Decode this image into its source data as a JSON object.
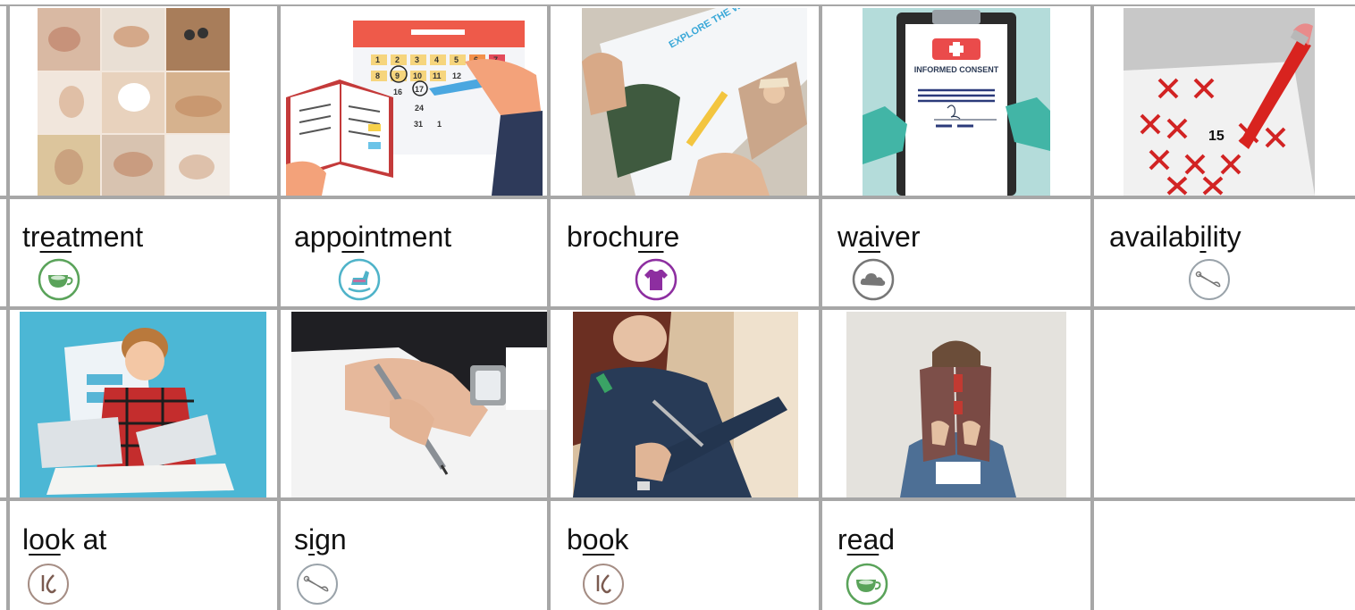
{
  "rows": [
    {
      "words": [
        {
          "pre": "tr",
          "key": "ea",
          "post": "tment",
          "icon": "teacup-icon",
          "icon_color": "#5aa35a"
        },
        {
          "pre": "app",
          "key": "oi",
          "post": "ntment",
          "icon": "rocking-horse-icon",
          "icon_color": "#4fb3c9"
        },
        {
          "pre": "broch",
          "key": "ur",
          "post": "e",
          "icon": "tshirt-icon",
          "icon_color": "#8d2ea0"
        },
        {
          "pre": "w",
          "key": "ai",
          "post": "ver",
          "icon": "cloud-icon",
          "icon_color": "#777777"
        },
        {
          "pre": "availab",
          "key": "i",
          "post": "lity",
          "icon": "safety-pin-icon",
          "icon_color": "#9aa3aa"
        }
      ]
    },
    {
      "words": [
        {
          "pre": "l",
          "key": "oo",
          "post": "k at",
          "icon": "hook-icon",
          "icon_color": "#a58d84"
        },
        {
          "pre": "s",
          "key": "i",
          "post": "gn",
          "icon": "safety-pin-icon",
          "icon_color": "#9aa3aa"
        },
        {
          "pre": "b",
          "key": "oo",
          "post": "k",
          "icon": "hook-icon",
          "icon_color": "#a58d84"
        },
        {
          "pre": "r",
          "key": "ea",
          "post": "d",
          "icon": "teacup-icon",
          "icon_color": "#5aa35a"
        }
      ]
    }
  ],
  "calendar_numbers": [
    "1",
    "2",
    "3",
    "4",
    "5",
    "6",
    "7",
    "8",
    "9",
    "10",
    "11",
    "12",
    "16",
    "17",
    "24",
    "31",
    "1"
  ],
  "consent_title": "INFORMED CONSENT",
  "brochure_text": "EXPLORE THE WORLD"
}
